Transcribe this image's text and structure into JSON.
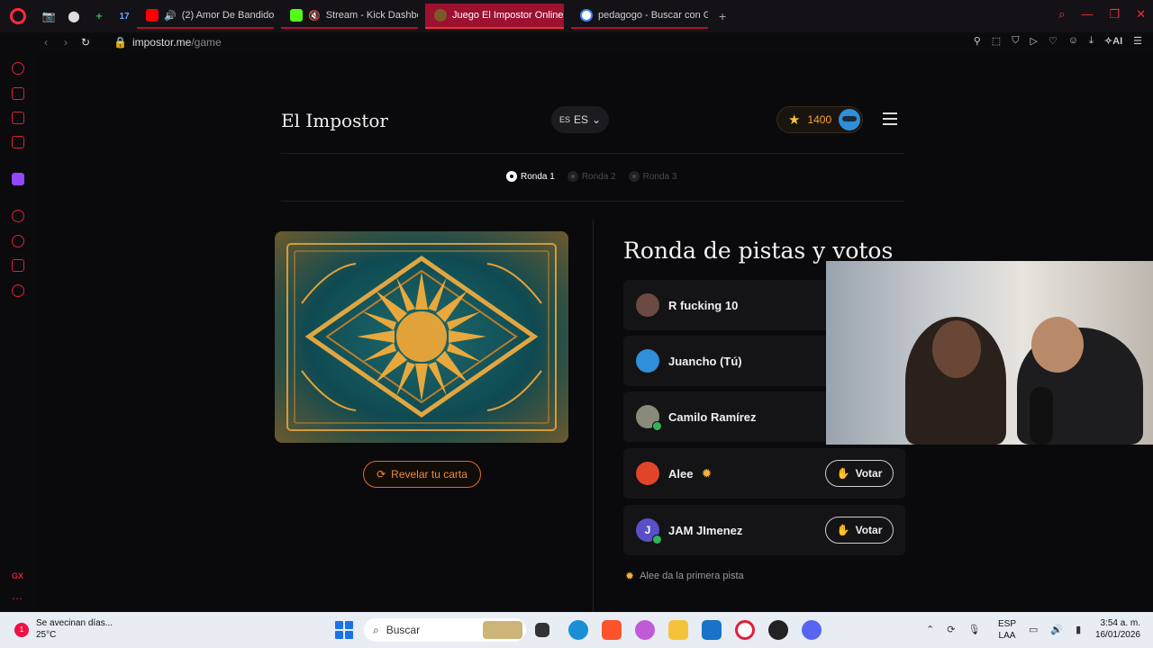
{
  "browser": {
    "tabs": [
      {
        "label": "(2) Amor De Bandidos",
        "fav_color": "#ff0000"
      },
      {
        "label": "Stream - Kick Dashboa",
        "fav_color": "#53fc18"
      },
      {
        "label": "Juego El Impostor Online",
        "fav_color": "#7a5a2a",
        "active": true
      },
      {
        "label": "pedagogo - Buscar con Go",
        "fav_color": "#4285f4"
      }
    ],
    "pinned": [
      "📷",
      "⬤",
      "+",
      "17"
    ],
    "url_host": "impostor.me",
    "url_path": "/game",
    "ai_label": "AI"
  },
  "header": {
    "brand": "El Impostor",
    "lang_flag": "ES",
    "lang_label": "ES",
    "coins": "1400"
  },
  "rounds": [
    {
      "label": "Ronda 1",
      "active": true
    },
    {
      "label": "Ronda 2",
      "active": false
    },
    {
      "label": "Ronda 3",
      "active": false
    }
  ],
  "card": {
    "reveal_label": "Revelar tu carta"
  },
  "section_title": "Ronda de pistas y votos",
  "players": [
    {
      "name": "R fucking 10",
      "avatar_color": "#6b4a44",
      "initial": "",
      "verified": false,
      "sun": false,
      "vote": false
    },
    {
      "name": "Juancho (Tú)",
      "avatar_color": "#2f8fd8",
      "initial": "",
      "verified": false,
      "sun": false,
      "vote": false
    },
    {
      "name": "Camilo Ramírez",
      "avatar_color": "#8a8a7a",
      "initial": "",
      "verified": true,
      "sun": false,
      "vote": false
    },
    {
      "name": "Alee",
      "avatar_color": "#e0452a",
      "initial": "",
      "verified": false,
      "sun": true,
      "vote": true
    },
    {
      "name": "JAM JImenez",
      "avatar_color": "#5a4fc8",
      "initial": "J",
      "verified": true,
      "sun": false,
      "vote": true
    }
  ],
  "vote_label": "Votar",
  "hint": "Alee da la primera pista",
  "taskbar": {
    "weather_title": "Se avecinan días...",
    "weather_temp": "25°C",
    "weather_badge": "1",
    "search_placeholder": "Buscar",
    "lang_top": "ESP",
    "lang_bottom": "LAA",
    "time": "3:54 a. m.",
    "date": "16/01/2026"
  }
}
